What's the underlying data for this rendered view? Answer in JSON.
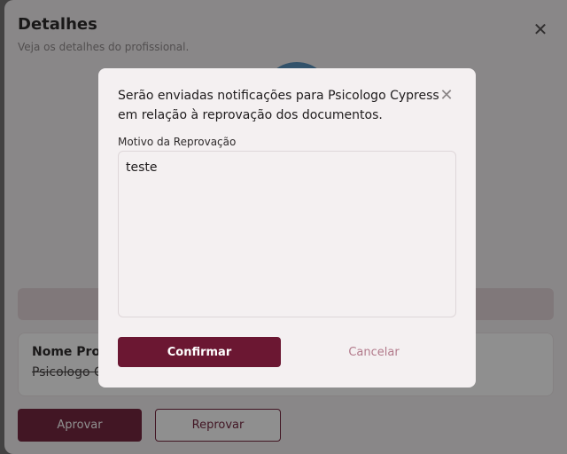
{
  "details": {
    "title": "Detalhes",
    "subtitle": "Veja os detalhes do profissional.",
    "close_icon": "close-icon",
    "name_label": "Nome Prof",
    "name_value": "Psicologo C",
    "approve_label": "Aprovar",
    "reject_label": "Reprovar"
  },
  "modal": {
    "message": "Serão enviadas notificações para Psicologo Cypress em relação à reprovação dos documentos.",
    "close_icon": "close-icon",
    "field_label": "Motivo da Reprovação",
    "field_value": "teste",
    "confirm_label": "Confirmar",
    "cancel_label": "Cancelar"
  },
  "colors": {
    "primary": "#6b1732",
    "cancel_text": "#b27a8b",
    "surface": "#f4f0f1"
  }
}
